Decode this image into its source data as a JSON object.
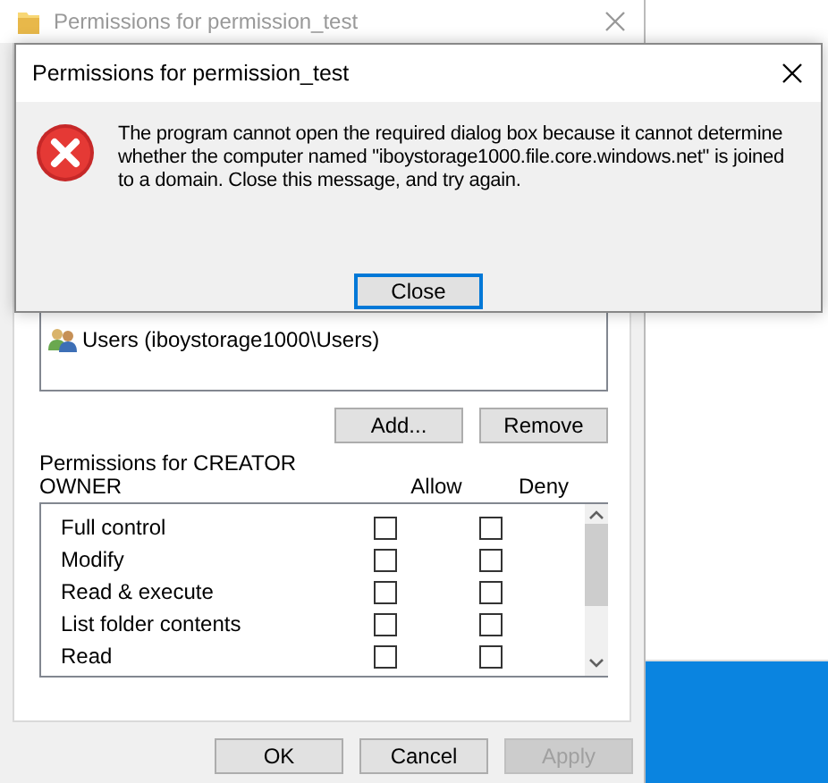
{
  "background_window": {
    "title": "Permissions for permission_test",
    "active": false
  },
  "groups": [
    {
      "name": "Users (iboystorage1000\\Users)"
    }
  ],
  "group_buttons": [
    "Add...",
    "Remove"
  ],
  "permissions_label": "Permissions for CREATOR OWNER",
  "columns": [
    "Allow",
    "Deny"
  ],
  "permissions": [
    {
      "name": "Full control",
      "allow": false,
      "deny": false
    },
    {
      "name": "Modify",
      "allow": false,
      "deny": false
    },
    {
      "name": "Read & execute",
      "allow": false,
      "deny": false
    },
    {
      "name": "List folder contents",
      "allow": false,
      "deny": false
    },
    {
      "name": "Read",
      "allow": false,
      "deny": false
    }
  ],
  "dialog_buttons": [
    {
      "label": "OK",
      "disabled": false
    },
    {
      "label": "Cancel",
      "disabled": false
    },
    {
      "label": "Apply",
      "disabled": true
    }
  ],
  "error_dialog": {
    "title": "Permissions for permission_test",
    "message": "The program cannot open the required dialog box because it cannot determine whether the computer named \"iboystorage1000.file.core.windows.net\" is joined to a domain. Close this message, and try again.",
    "button": "Close"
  }
}
